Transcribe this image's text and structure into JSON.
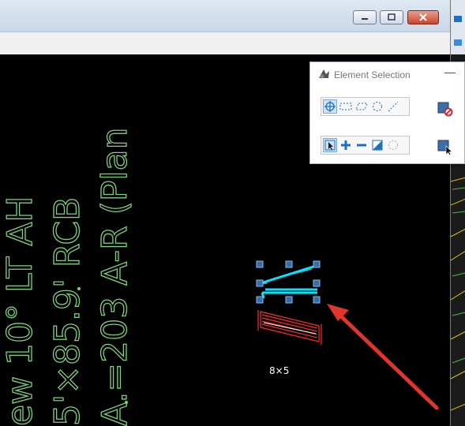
{
  "window": {
    "buttons": {
      "minimize": "minimize",
      "maximize": "maximize",
      "close": "close"
    }
  },
  "canvas": {
    "vertical_texts": [
      "ew 10° LT AH",
      "5'×85.9' RCB",
      "A.=203 A-R (Plan"
    ],
    "element_label": "8×5"
  },
  "dialog": {
    "title": "Element Selection",
    "minimize_symbol": "—",
    "rows": [
      {
        "name": "selection-methods",
        "tools": [
          "individual",
          "block",
          "shape",
          "circle",
          "line"
        ]
      },
      {
        "name": "selection-modes",
        "tools": [
          "new",
          "add",
          "subtract",
          "invert",
          "clear"
        ]
      }
    ],
    "side_buttons": [
      "clear-selection",
      "select-all"
    ]
  },
  "colors": {
    "accent": "#1e70c2",
    "cad_text": "#7fd07f",
    "selected_element": "#00e5ff",
    "red_element": "#ff2b2b",
    "arrow": "#e0352b"
  }
}
